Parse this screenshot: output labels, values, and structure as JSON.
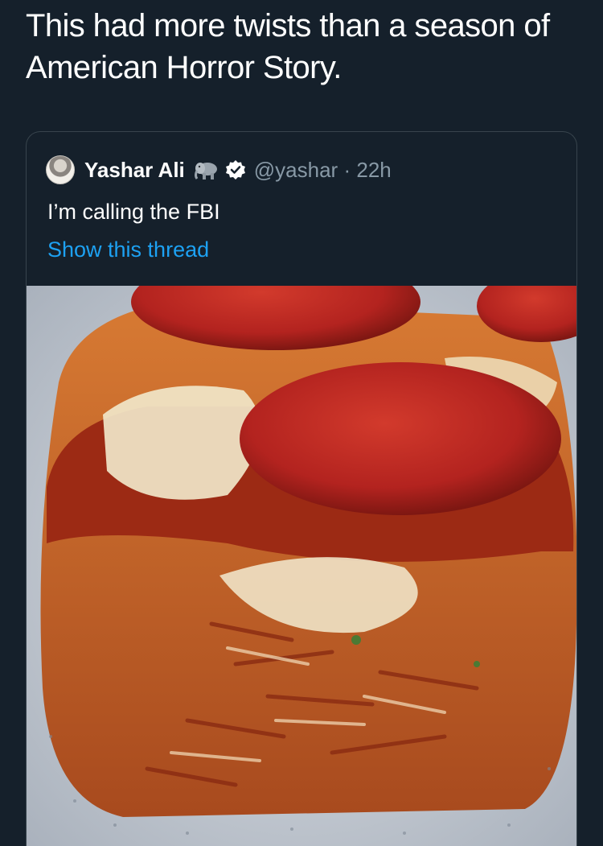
{
  "tweet": {
    "text": "This had more twists than a season of American Horror Story."
  },
  "quoted_tweet": {
    "author_name": "Yashar Ali",
    "author_emoji": "elephant-icon",
    "verified": true,
    "handle": "@yashar",
    "separator": "·",
    "time": "22h",
    "body": "I’m calling the FBI",
    "show_thread_label": "Show this thread",
    "media": {
      "description_icon": "food-photo",
      "colors": {
        "pepperoni": "#b3231f",
        "sauce": "#9c2a14",
        "crust": "#c8642a",
        "cheese": "#f1e6c9",
        "plate": "#c9ced6"
      }
    }
  },
  "colors": {
    "background": "#15202b",
    "border": "#38444d",
    "secondary_text": "#8899a6",
    "link": "#1da1f2"
  }
}
